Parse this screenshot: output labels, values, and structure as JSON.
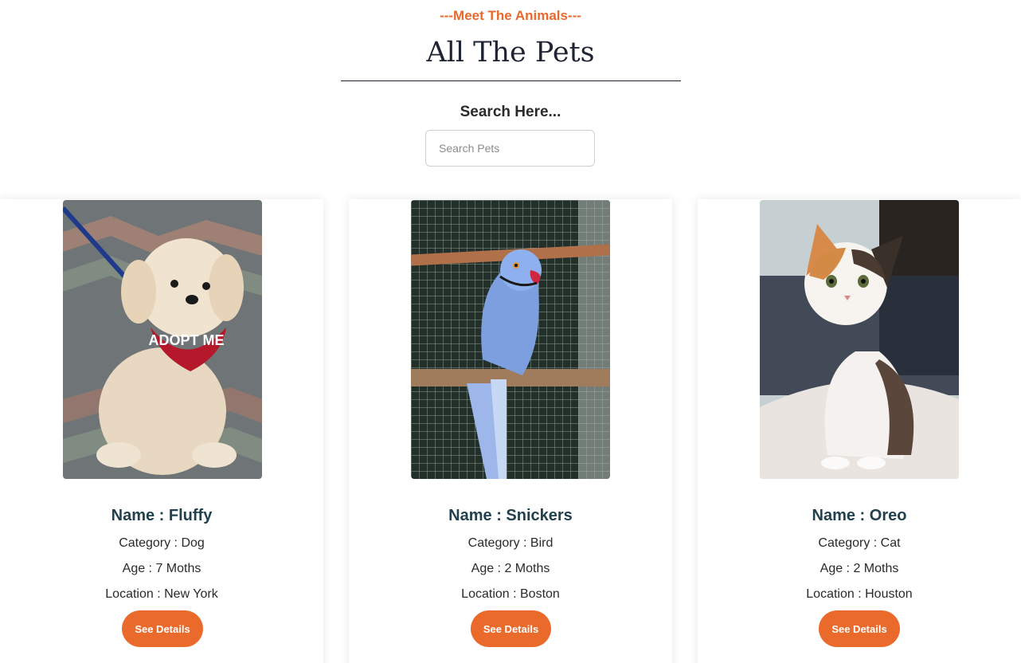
{
  "header": {
    "eyebrow": "---Meet The Animals---",
    "title": "All The Pets"
  },
  "search": {
    "label": "Search Here...",
    "placeholder": "Search Pets",
    "value": ""
  },
  "pets": [
    {
      "name": "Name : Fluffy",
      "category": "Category : Dog",
      "age": "Age : 7 Moths",
      "location": "Location : New York",
      "button": "See Details",
      "photo_badge": "ADOPT ME"
    },
    {
      "name": "Name : Snickers",
      "category": "Category : Bird",
      "age": "Age : 2 Moths",
      "location": "Location : Boston",
      "button": "See Details"
    },
    {
      "name": "Name : Oreo",
      "category": "Category : Cat",
      "age": "Age : 2 Moths",
      "location": "Location : Houston",
      "button": "See Details"
    }
  ],
  "colors": {
    "accent": "#ea6a2c",
    "title": "#1f2433",
    "name": "#22404d"
  }
}
